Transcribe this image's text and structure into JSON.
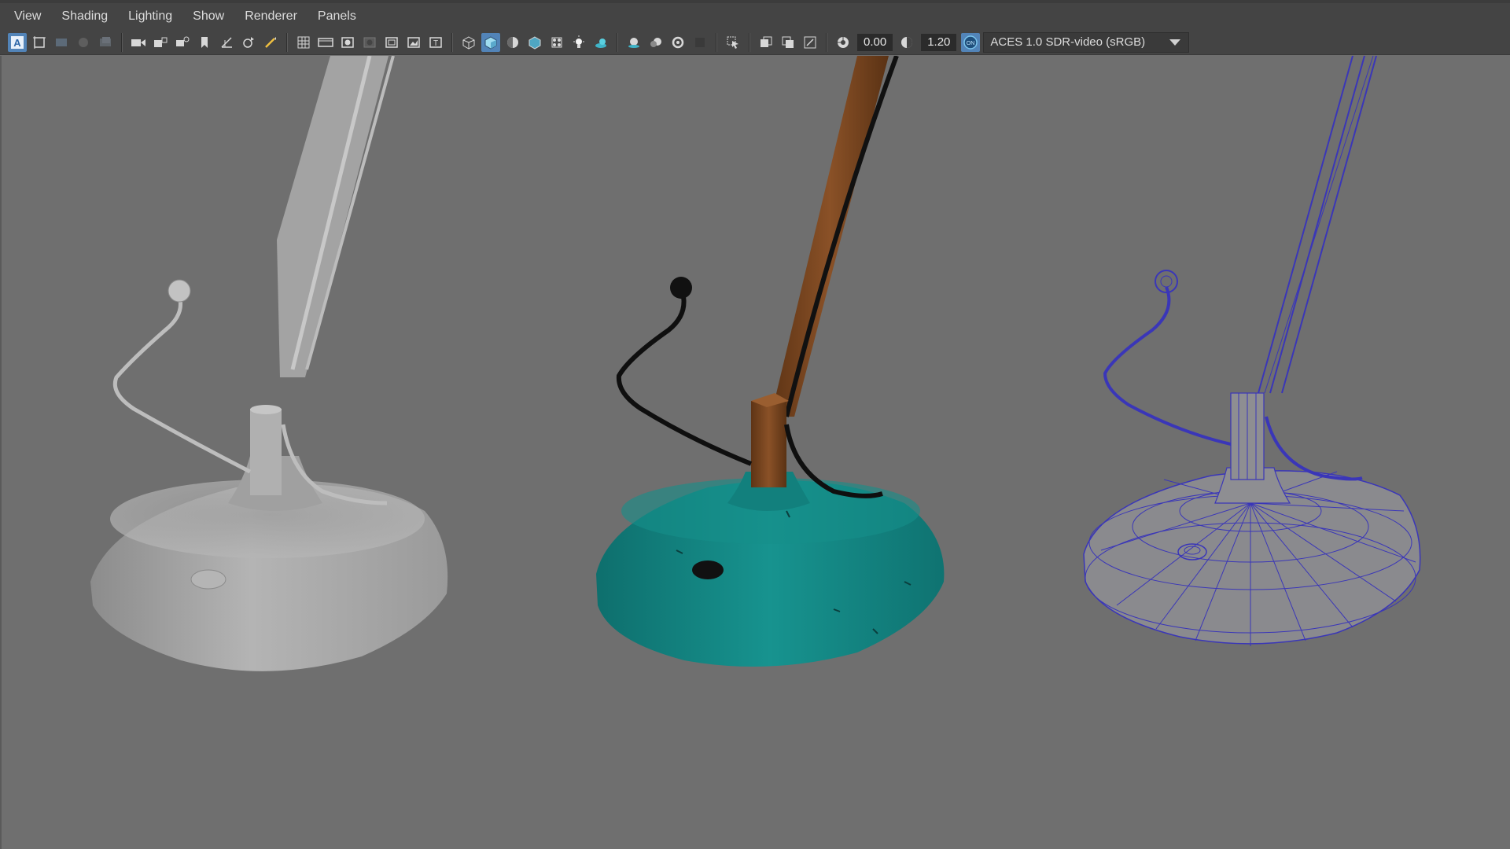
{
  "menubar": {
    "items": [
      "View",
      "Shading",
      "Lighting",
      "Show",
      "Renderer",
      "Panels"
    ]
  },
  "toolbar": {
    "icons": [
      "select-camera-icon",
      "camera-attributes-icon",
      "bookmarks-icon",
      "image-plane-icon",
      "2d-pan-zoom-icon",
      "camera-icon",
      "lock-camera-icon",
      "grease-pencil-icon",
      "bookmark-icon",
      "grid-icon",
      "film-gate-icon",
      "resolution-gate-icon",
      "gate-mask-icon",
      "field-chart-icon",
      "safe-action-icon",
      "safe-title-icon",
      "wireframe-icon",
      "smooth-shade-icon",
      "default-material-icon",
      "wireframe-on-shaded-icon",
      "xray-icon",
      "textured-icon",
      "lights-icon",
      "shadows-icon",
      "ambient-occlusion-icon",
      "motion-blur-icon",
      "multisample-aa-icon",
      "depth-of-field-icon",
      "isolate-select-icon",
      "xray-joints-icon",
      "xray-active-icon",
      "backface-culling-icon",
      "exposure-icon",
      "gamma-icon",
      "color-management-icon"
    ],
    "exposure_value": "0.00",
    "gamma_value": "1.20",
    "color_management_toggle": "ON",
    "view_transform": "ACES 1.0 SDR-video (sRGB)"
  },
  "viewport": {
    "background_color": "#6f6f6f",
    "objects": [
      {
        "name": "Lamp base (shaded, untextured)",
        "shading": "smooth-shade",
        "color": "#a8a8a8"
      },
      {
        "name": "Lamp base (textured)",
        "shading": "textured",
        "color": "#178c8a",
        "arm_color": "#7a4520"
      },
      {
        "name": "Lamp base (wireframe)",
        "shading": "wireframe",
        "color": "#3a36b8"
      }
    ]
  }
}
